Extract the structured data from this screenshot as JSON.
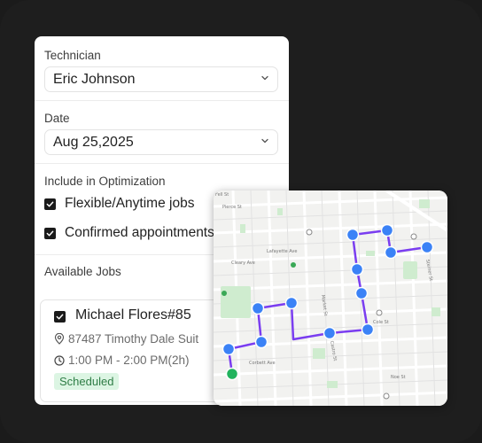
{
  "technician": {
    "label": "Technician",
    "value": "Eric Johnson"
  },
  "date": {
    "label": "Date",
    "value": "Aug 25,2025"
  },
  "optimization": {
    "label": "Include in Optimization",
    "options": [
      {
        "label": "Flexible/Anytime jobs",
        "checked": true
      },
      {
        "label": "Confirmed appointments",
        "checked": true
      }
    ]
  },
  "jobs": {
    "label": "Available Jobs",
    "items": [
      {
        "title": "Michael Flores#85",
        "address": "87487 Timothy Dale Suit",
        "time": "1:00 PM - 2:00 PM(2h)",
        "status": "Scheduled",
        "checked": true
      }
    ]
  },
  "map": {
    "street_labels": [
      "Fell St",
      "Cleary Ave",
      "Lafayette Ave",
      "Market St",
      "Pierce St",
      "Corbett Ave",
      "Cole St",
      "Steiner St",
      "Castro St",
      "Noe St"
    ],
    "route_color": "#7a3df0",
    "stop_color": "#3b82f6",
    "start_color": "#22b35e"
  }
}
